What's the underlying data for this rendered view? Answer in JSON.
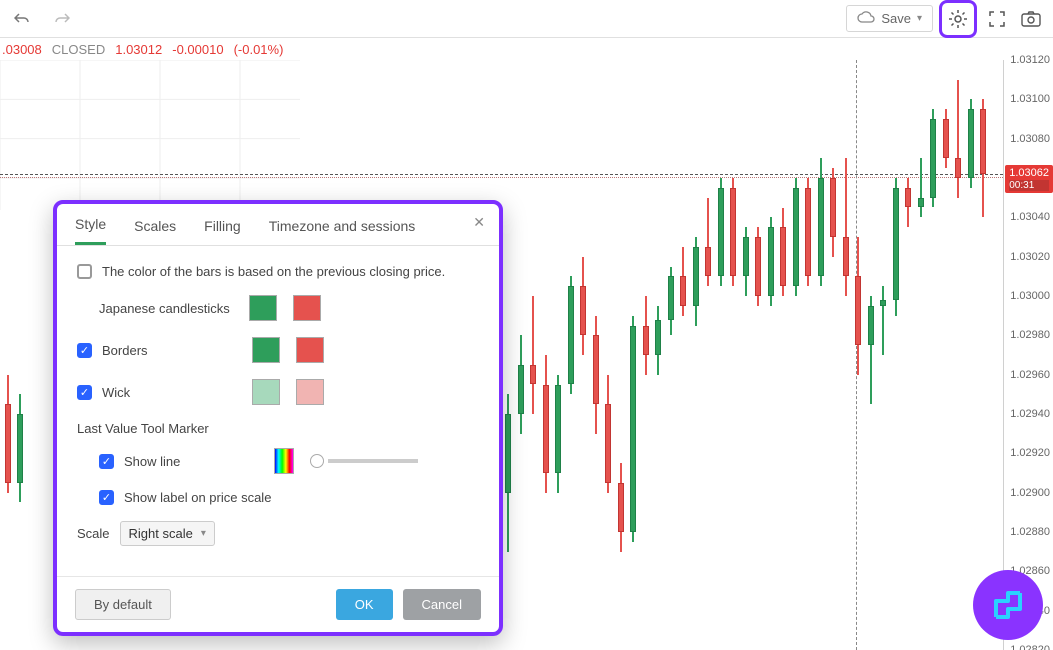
{
  "toolbar": {
    "save_label": "Save"
  },
  "quote": {
    "price": ".03008",
    "status": "CLOSED",
    "close": "1.03012",
    "change": "-0.00010",
    "pct": "(-0.01%)"
  },
  "price_badge": {
    "value": "1.03062",
    "countdown": "00:31"
  },
  "axis_ticks": [
    "1.03120",
    "1.03100",
    "1.03080",
    "1.03060",
    "1.03040",
    "1.03020",
    "1.03000",
    "1.02980",
    "1.02960",
    "1.02940",
    "1.02920",
    "1.02900",
    "1.02880",
    "1.02860",
    "1.02840",
    "1.02820"
  ],
  "dialog": {
    "tabs": {
      "style": "Style",
      "scales": "Scales",
      "filling": "Filling",
      "tz": "Timezone and sessions"
    },
    "prev_close_label": "The color of the bars is based on the previous closing price.",
    "jp_label": "Japanese candlesticks",
    "borders_label": "Borders",
    "wick_label": "Wick",
    "lvtm_heading": "Last Value Tool Marker",
    "show_line_label": "Show line",
    "show_label_label": "Show label on price scale",
    "scale_label": "Scale",
    "scale_value": "Right scale",
    "default_btn": "By default",
    "ok_btn": "OK",
    "cancel_btn": "Cancel"
  },
  "chart_data": {
    "type": "candlestick",
    "ylim": [
      1.0282,
      1.0312
    ],
    "xaxis_visible": false,
    "last_price_line": 1.03062,
    "series": [
      {
        "o": 1.029,
        "h": 1.0295,
        "l": 1.0287,
        "c": 1.0294
      },
      {
        "o": 1.0294,
        "h": 1.0298,
        "l": 1.0293,
        "c": 1.02965
      },
      {
        "o": 1.02965,
        "h": 1.03,
        "l": 1.0294,
        "c": 1.02955
      },
      {
        "o": 1.02955,
        "h": 1.0297,
        "l": 1.029,
        "c": 1.0291
      },
      {
        "o": 1.0291,
        "h": 1.0296,
        "l": 1.029,
        "c": 1.02955
      },
      {
        "o": 1.02955,
        "h": 1.0301,
        "l": 1.0295,
        "c": 1.03005
      },
      {
        "o": 1.03005,
        "h": 1.0302,
        "l": 1.0297,
        "c": 1.0298
      },
      {
        "o": 1.0298,
        "h": 1.0299,
        "l": 1.0293,
        "c": 1.02945
      },
      {
        "o": 1.02945,
        "h": 1.0296,
        "l": 1.029,
        "c": 1.02905
      },
      {
        "o": 1.02905,
        "h": 1.02915,
        "l": 1.0287,
        "c": 1.0288
      },
      {
        "o": 1.0288,
        "h": 1.0299,
        "l": 1.02875,
        "c": 1.02985
      },
      {
        "o": 1.02985,
        "h": 1.03,
        "l": 1.0296,
        "c": 1.0297
      },
      {
        "o": 1.0297,
        "h": 1.02995,
        "l": 1.0296,
        "c": 1.02988
      },
      {
        "o": 1.02988,
        "h": 1.03015,
        "l": 1.0298,
        "c": 1.0301
      },
      {
        "o": 1.0301,
        "h": 1.03025,
        "l": 1.0299,
        "c": 1.02995
      },
      {
        "o": 1.02995,
        "h": 1.0303,
        "l": 1.02985,
        "c": 1.03025
      },
      {
        "o": 1.03025,
        "h": 1.0305,
        "l": 1.03005,
        "c": 1.0301
      },
      {
        "o": 1.0301,
        "h": 1.0306,
        "l": 1.03005,
        "c": 1.03055
      },
      {
        "o": 1.03055,
        "h": 1.0306,
        "l": 1.03005,
        "c": 1.0301
      },
      {
        "o": 1.0301,
        "h": 1.03035,
        "l": 1.03,
        "c": 1.0303
      },
      {
        "o": 1.0303,
        "h": 1.03035,
        "l": 1.02995,
        "c": 1.03
      },
      {
        "o": 1.03,
        "h": 1.0304,
        "l": 1.02995,
        "c": 1.03035
      },
      {
        "o": 1.03035,
        "h": 1.03045,
        "l": 1.03,
        "c": 1.03005
      },
      {
        "o": 1.03005,
        "h": 1.0306,
        "l": 1.03,
        "c": 1.03055
      },
      {
        "o": 1.03055,
        "h": 1.0306,
        "l": 1.03005,
        "c": 1.0301
      },
      {
        "o": 1.0301,
        "h": 1.0307,
        "l": 1.03005,
        "c": 1.0306
      },
      {
        "o": 1.0306,
        "h": 1.03065,
        "l": 1.0302,
        "c": 1.0303
      },
      {
        "o": 1.0303,
        "h": 1.0307,
        "l": 1.03,
        "c": 1.0301
      },
      {
        "o": 1.0301,
        "h": 1.0303,
        "l": 1.0296,
        "c": 1.02975
      },
      {
        "o": 1.02975,
        "h": 1.03,
        "l": 1.02945,
        "c": 1.02995
      },
      {
        "o": 1.02995,
        "h": 1.03005,
        "l": 1.0297,
        "c": 1.02998
      },
      {
        "o": 1.02998,
        "h": 1.0306,
        "l": 1.0299,
        "c": 1.03055
      },
      {
        "o": 1.03055,
        "h": 1.0306,
        "l": 1.03035,
        "c": 1.03045
      },
      {
        "o": 1.03045,
        "h": 1.0307,
        "l": 1.0304,
        "c": 1.0305
      },
      {
        "o": 1.0305,
        "h": 1.03095,
        "l": 1.03045,
        "c": 1.0309
      },
      {
        "o": 1.0309,
        "h": 1.03095,
        "l": 1.03065,
        "c": 1.0307
      },
      {
        "o": 1.0307,
        "h": 1.0311,
        "l": 1.0305,
        "c": 1.0306
      },
      {
        "o": 1.0306,
        "h": 1.031,
        "l": 1.03055,
        "c": 1.03095
      },
      {
        "o": 1.03095,
        "h": 1.031,
        "l": 1.0304,
        "c": 1.03062
      }
    ]
  }
}
